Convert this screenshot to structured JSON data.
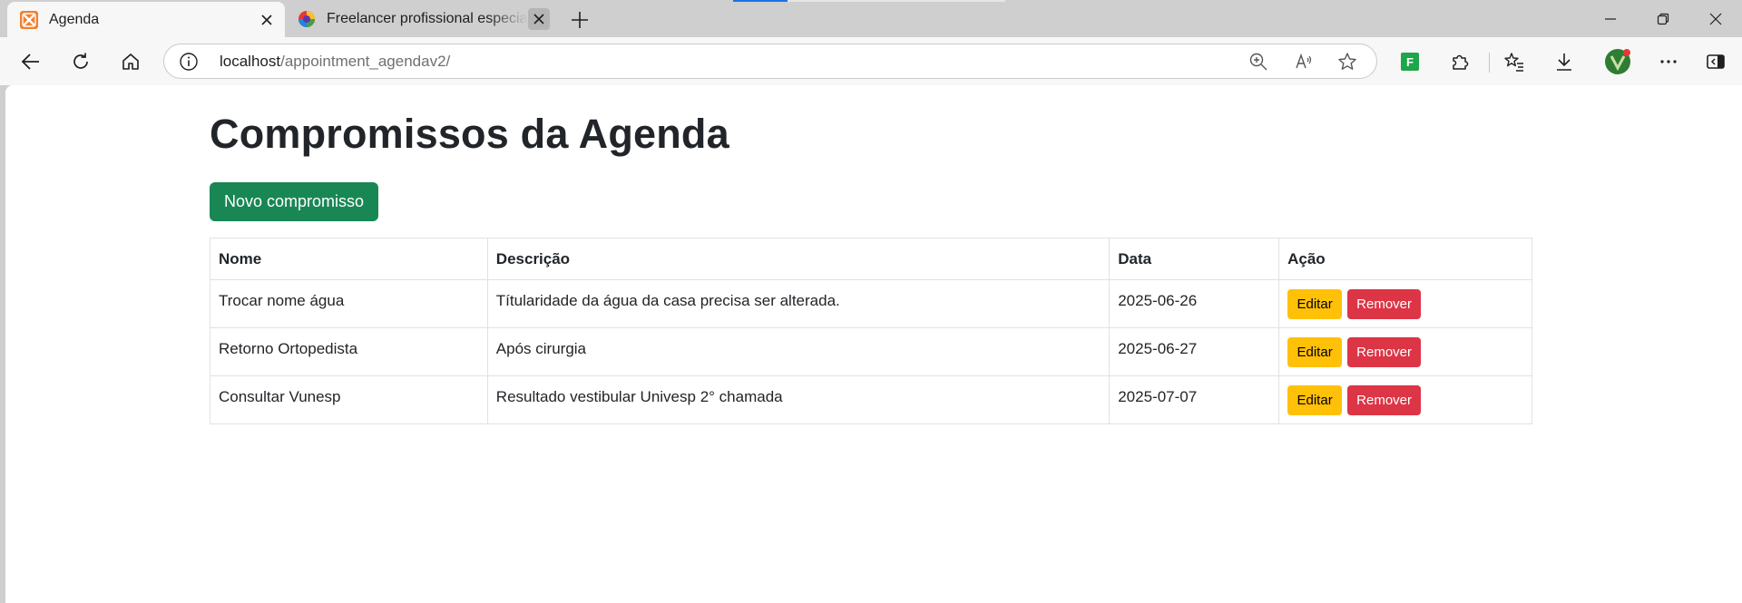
{
  "tabs": [
    {
      "title": "Agenda",
      "active": true
    },
    {
      "title": "Freelancer profissional especialista",
      "active": false
    }
  ],
  "address_bar": {
    "host": "localhost",
    "path": "/appointment_agendav2/"
  },
  "extension_badge": "F",
  "page": {
    "title": "Compromissos da Agenda",
    "new_button": "Novo compromisso",
    "table": {
      "headers": {
        "name": "Nome",
        "description": "Descrição",
        "date": "Data",
        "action": "Ação"
      },
      "rows": [
        {
          "name": "Trocar nome água",
          "description": "Títularidade da água da casa precisa ser alterada.",
          "date": "2025-06-26",
          "edit": "Editar",
          "remove": "Remover"
        },
        {
          "name": "Retorno Ortopedista",
          "description": "Após cirurgia",
          "date": "2025-06-27",
          "edit": "Editar",
          "remove": "Remover"
        },
        {
          "name": "Consultar Vunesp",
          "description": "Resultado vestibular Univesp 2° chamada",
          "date": "2025-07-07",
          "edit": "Editar",
          "remove": "Remover"
        }
      ]
    }
  },
  "colors": {
    "success": "#198754",
    "warning": "#ffc107",
    "danger": "#dc3545",
    "browser_chrome": "#f7f7f7"
  }
}
